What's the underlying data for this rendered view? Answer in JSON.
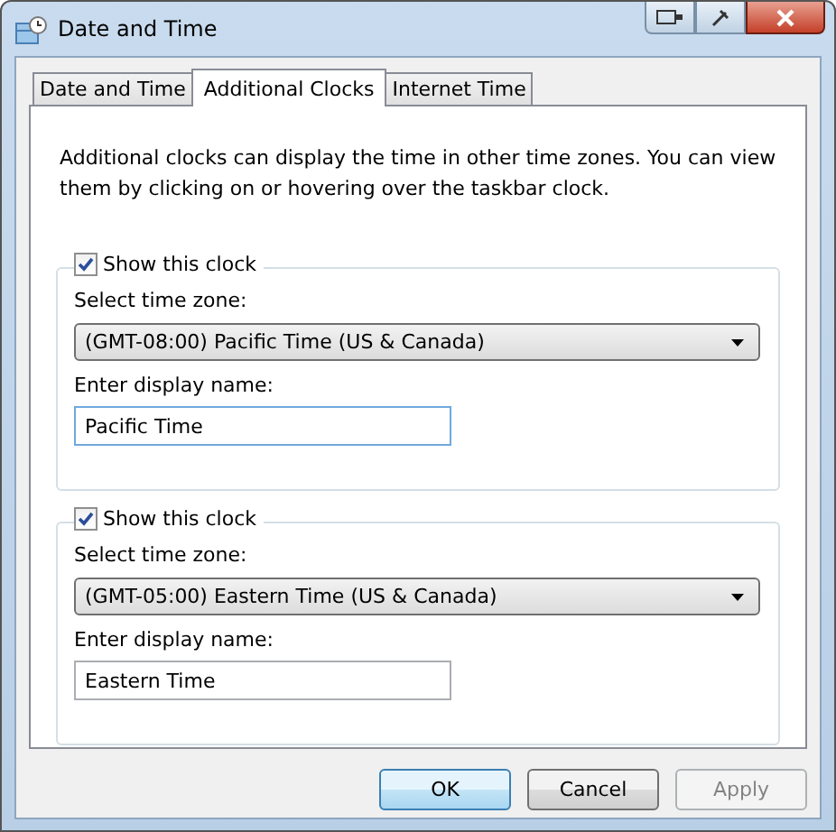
{
  "window": {
    "title": "Date and Time"
  },
  "tabs": [
    {
      "label": "Date and Time",
      "selected": false
    },
    {
      "label": "Additional Clocks",
      "selected": true
    },
    {
      "label": "Internet Time",
      "selected": false
    }
  ],
  "description": "Additional clocks can display the time in other time zones. You can view them by clicking on or hovering over the taskbar clock.",
  "clocks": [
    {
      "show_label": "Show this clock",
      "checked": true,
      "zone_label": "Select time zone:",
      "zone": "(GMT-08:00) Pacific Time (US & Canada)",
      "name_label": "Enter display name:",
      "name": "Pacific Time",
      "focused": true
    },
    {
      "show_label": "Show this clock",
      "checked": true,
      "zone_label": "Select time zone:",
      "zone": "(GMT-05:00) Eastern Time (US & Canada)",
      "name_label": "Enter display name:",
      "name": "Eastern Time",
      "focused": false
    }
  ],
  "buttons": [
    {
      "label": "OK",
      "default": true,
      "disabled": false
    },
    {
      "label": "Cancel",
      "default": false,
      "disabled": false
    },
    {
      "label": "Apply",
      "default": false,
      "disabled": true
    }
  ]
}
